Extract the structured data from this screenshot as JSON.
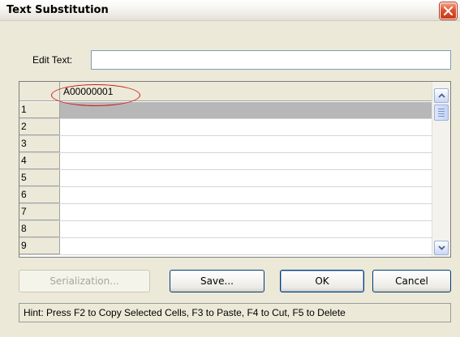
{
  "window": {
    "title": "Text Substitution"
  },
  "edit": {
    "label": "Edit Text:",
    "value": ""
  },
  "grid": {
    "column_header": "A00000001",
    "rows": [
      "1",
      "2",
      "3",
      "4",
      "5",
      "6",
      "7",
      "8",
      "9"
    ],
    "selected_row": "1"
  },
  "buttons": {
    "serialization": "Serialization...",
    "save": "Save...",
    "ok": "OK",
    "cancel": "Cancel"
  },
  "hint": "Hint: Press F2 to Copy Selected Cells, F3 to Paste, F4 to Cut, F5 to Delete",
  "colors": {
    "annotation_oval": "#d21a1a",
    "selected_cell": "#b7b7b7",
    "close_button": "#e0522e"
  }
}
